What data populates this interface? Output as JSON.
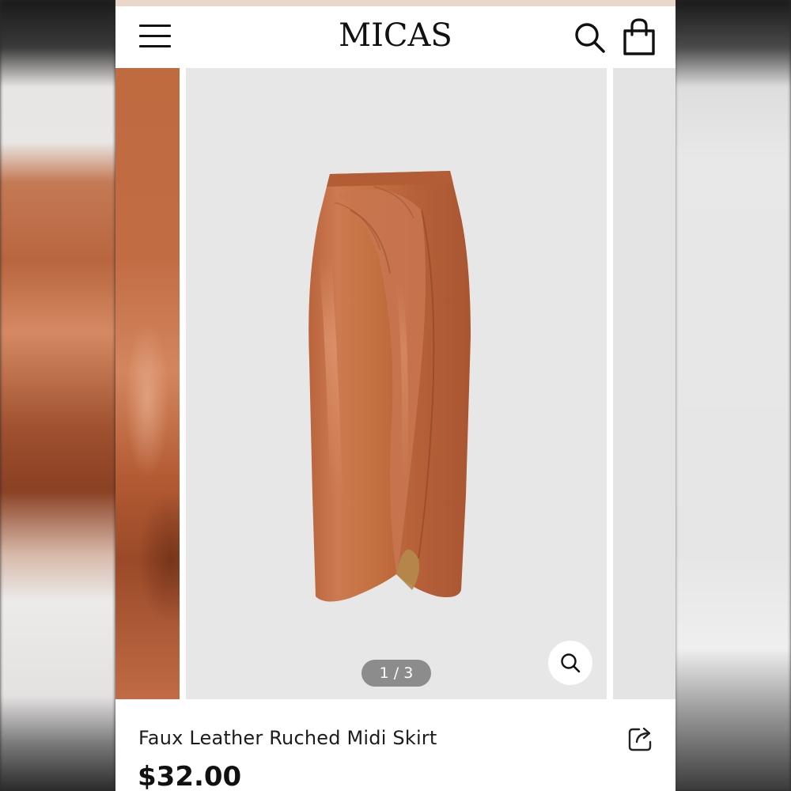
{
  "header": {
    "brand": "MICAS",
    "icons": [
      "menu-icon",
      "search-icon",
      "shopping-bag-icon"
    ]
  },
  "gallery": {
    "pager": "1 / 3",
    "current_index": 1,
    "total": 3,
    "zoom_icon": "zoom-icon"
  },
  "product": {
    "title": "Faux Leather Ruched Midi Skirt",
    "price": "$32.00",
    "share_icon": "share-icon"
  },
  "colors": {
    "promo_strip": "#e9d7cb",
    "skirt": "#c06a42",
    "gallery_bg": "#e7e7e7"
  }
}
